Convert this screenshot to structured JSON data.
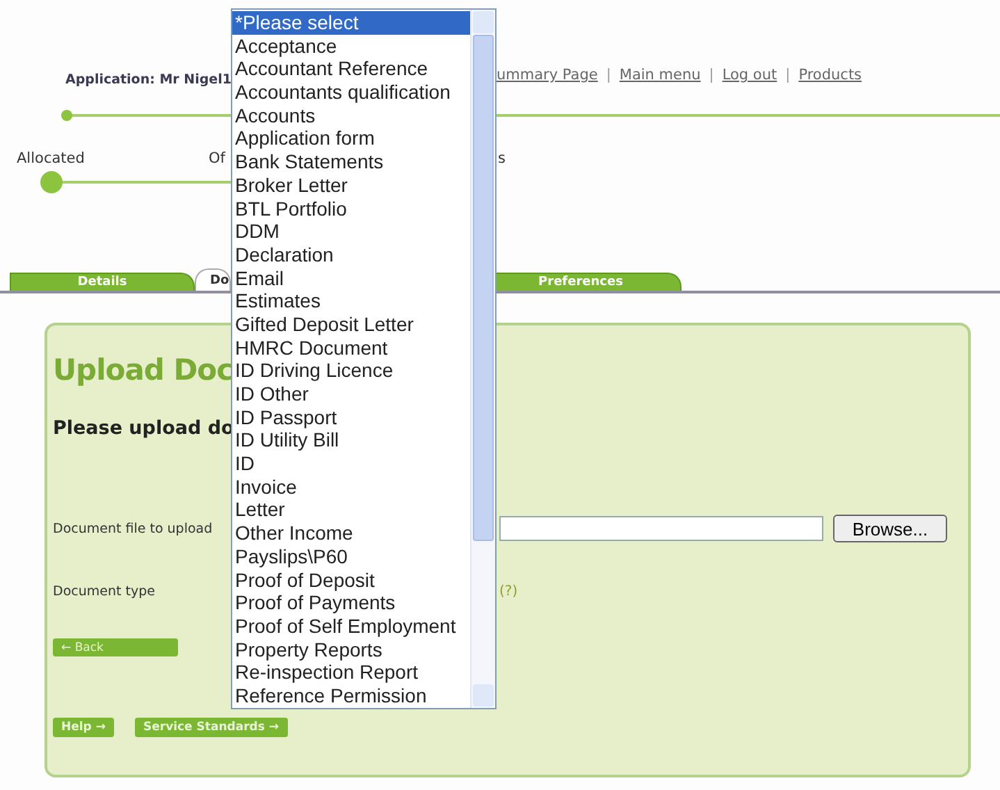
{
  "header": {
    "application": "Application: Mr Nigel1",
    "links": [
      "ummary Page",
      "Main menu",
      "Log out",
      "Products"
    ],
    "separator": "|"
  },
  "progress": {
    "stages": [
      "Allocated",
      "Of",
      "s"
    ]
  },
  "tabs": [
    {
      "label": "Details",
      "selected": false
    },
    {
      "label": "Do",
      "selected": true
    },
    {
      "label": "Preferences",
      "selected": false
    }
  ],
  "panel": {
    "title": "Upload Doc",
    "subtitle": "Please upload do",
    "file_label": "Document file to upload",
    "browse": "Browse...",
    "type_label": "Document type",
    "help_mark": "(?)",
    "back": {
      "arrow": "←",
      "label": "Back"
    },
    "footer_buttons": [
      {
        "label": "Help",
        "arrow": "→"
      },
      {
        "label": "Service Standards",
        "arrow": "→"
      }
    ]
  },
  "dropdown": {
    "options": [
      {
        "label": "*Please select",
        "selected": true
      },
      {
        "label": "Acceptance",
        "selected": false
      },
      {
        "label": "Accountant Reference",
        "selected": false
      },
      {
        "label": "Accountants qualification",
        "selected": false
      },
      {
        "label": "Accounts",
        "selected": false
      },
      {
        "label": "Application form",
        "selected": false
      },
      {
        "label": "Bank Statements",
        "selected": false
      },
      {
        "label": "Broker Letter",
        "selected": false
      },
      {
        "label": "BTL Portfolio",
        "selected": false
      },
      {
        "label": "DDM",
        "selected": false
      },
      {
        "label": "Declaration",
        "selected": false
      },
      {
        "label": "Email",
        "selected": false
      },
      {
        "label": "Estimates",
        "selected": false
      },
      {
        "label": "Gifted Deposit Letter",
        "selected": false
      },
      {
        "label": "HMRC Document",
        "selected": false
      },
      {
        "label": "ID Driving Licence",
        "selected": false
      },
      {
        "label": "ID Other",
        "selected": false
      },
      {
        "label": "ID Passport",
        "selected": false
      },
      {
        "label": "ID Utility Bill",
        "selected": false
      },
      {
        "label": "ID",
        "selected": false
      },
      {
        "label": "Invoice",
        "selected": false
      },
      {
        "label": "Letter",
        "selected": false
      },
      {
        "label": "Other Income",
        "selected": false
      },
      {
        "label": "Payslips\\P60",
        "selected": false
      },
      {
        "label": "Proof of Deposit",
        "selected": false
      },
      {
        "label": "Proof of Payments",
        "selected": false
      },
      {
        "label": "Proof of Self Employment",
        "selected": false
      },
      {
        "label": "Property Reports",
        "selected": false
      },
      {
        "label": "Re-inspection Report",
        "selected": false
      },
      {
        "label": "Reference Permission",
        "selected": false
      }
    ]
  }
}
